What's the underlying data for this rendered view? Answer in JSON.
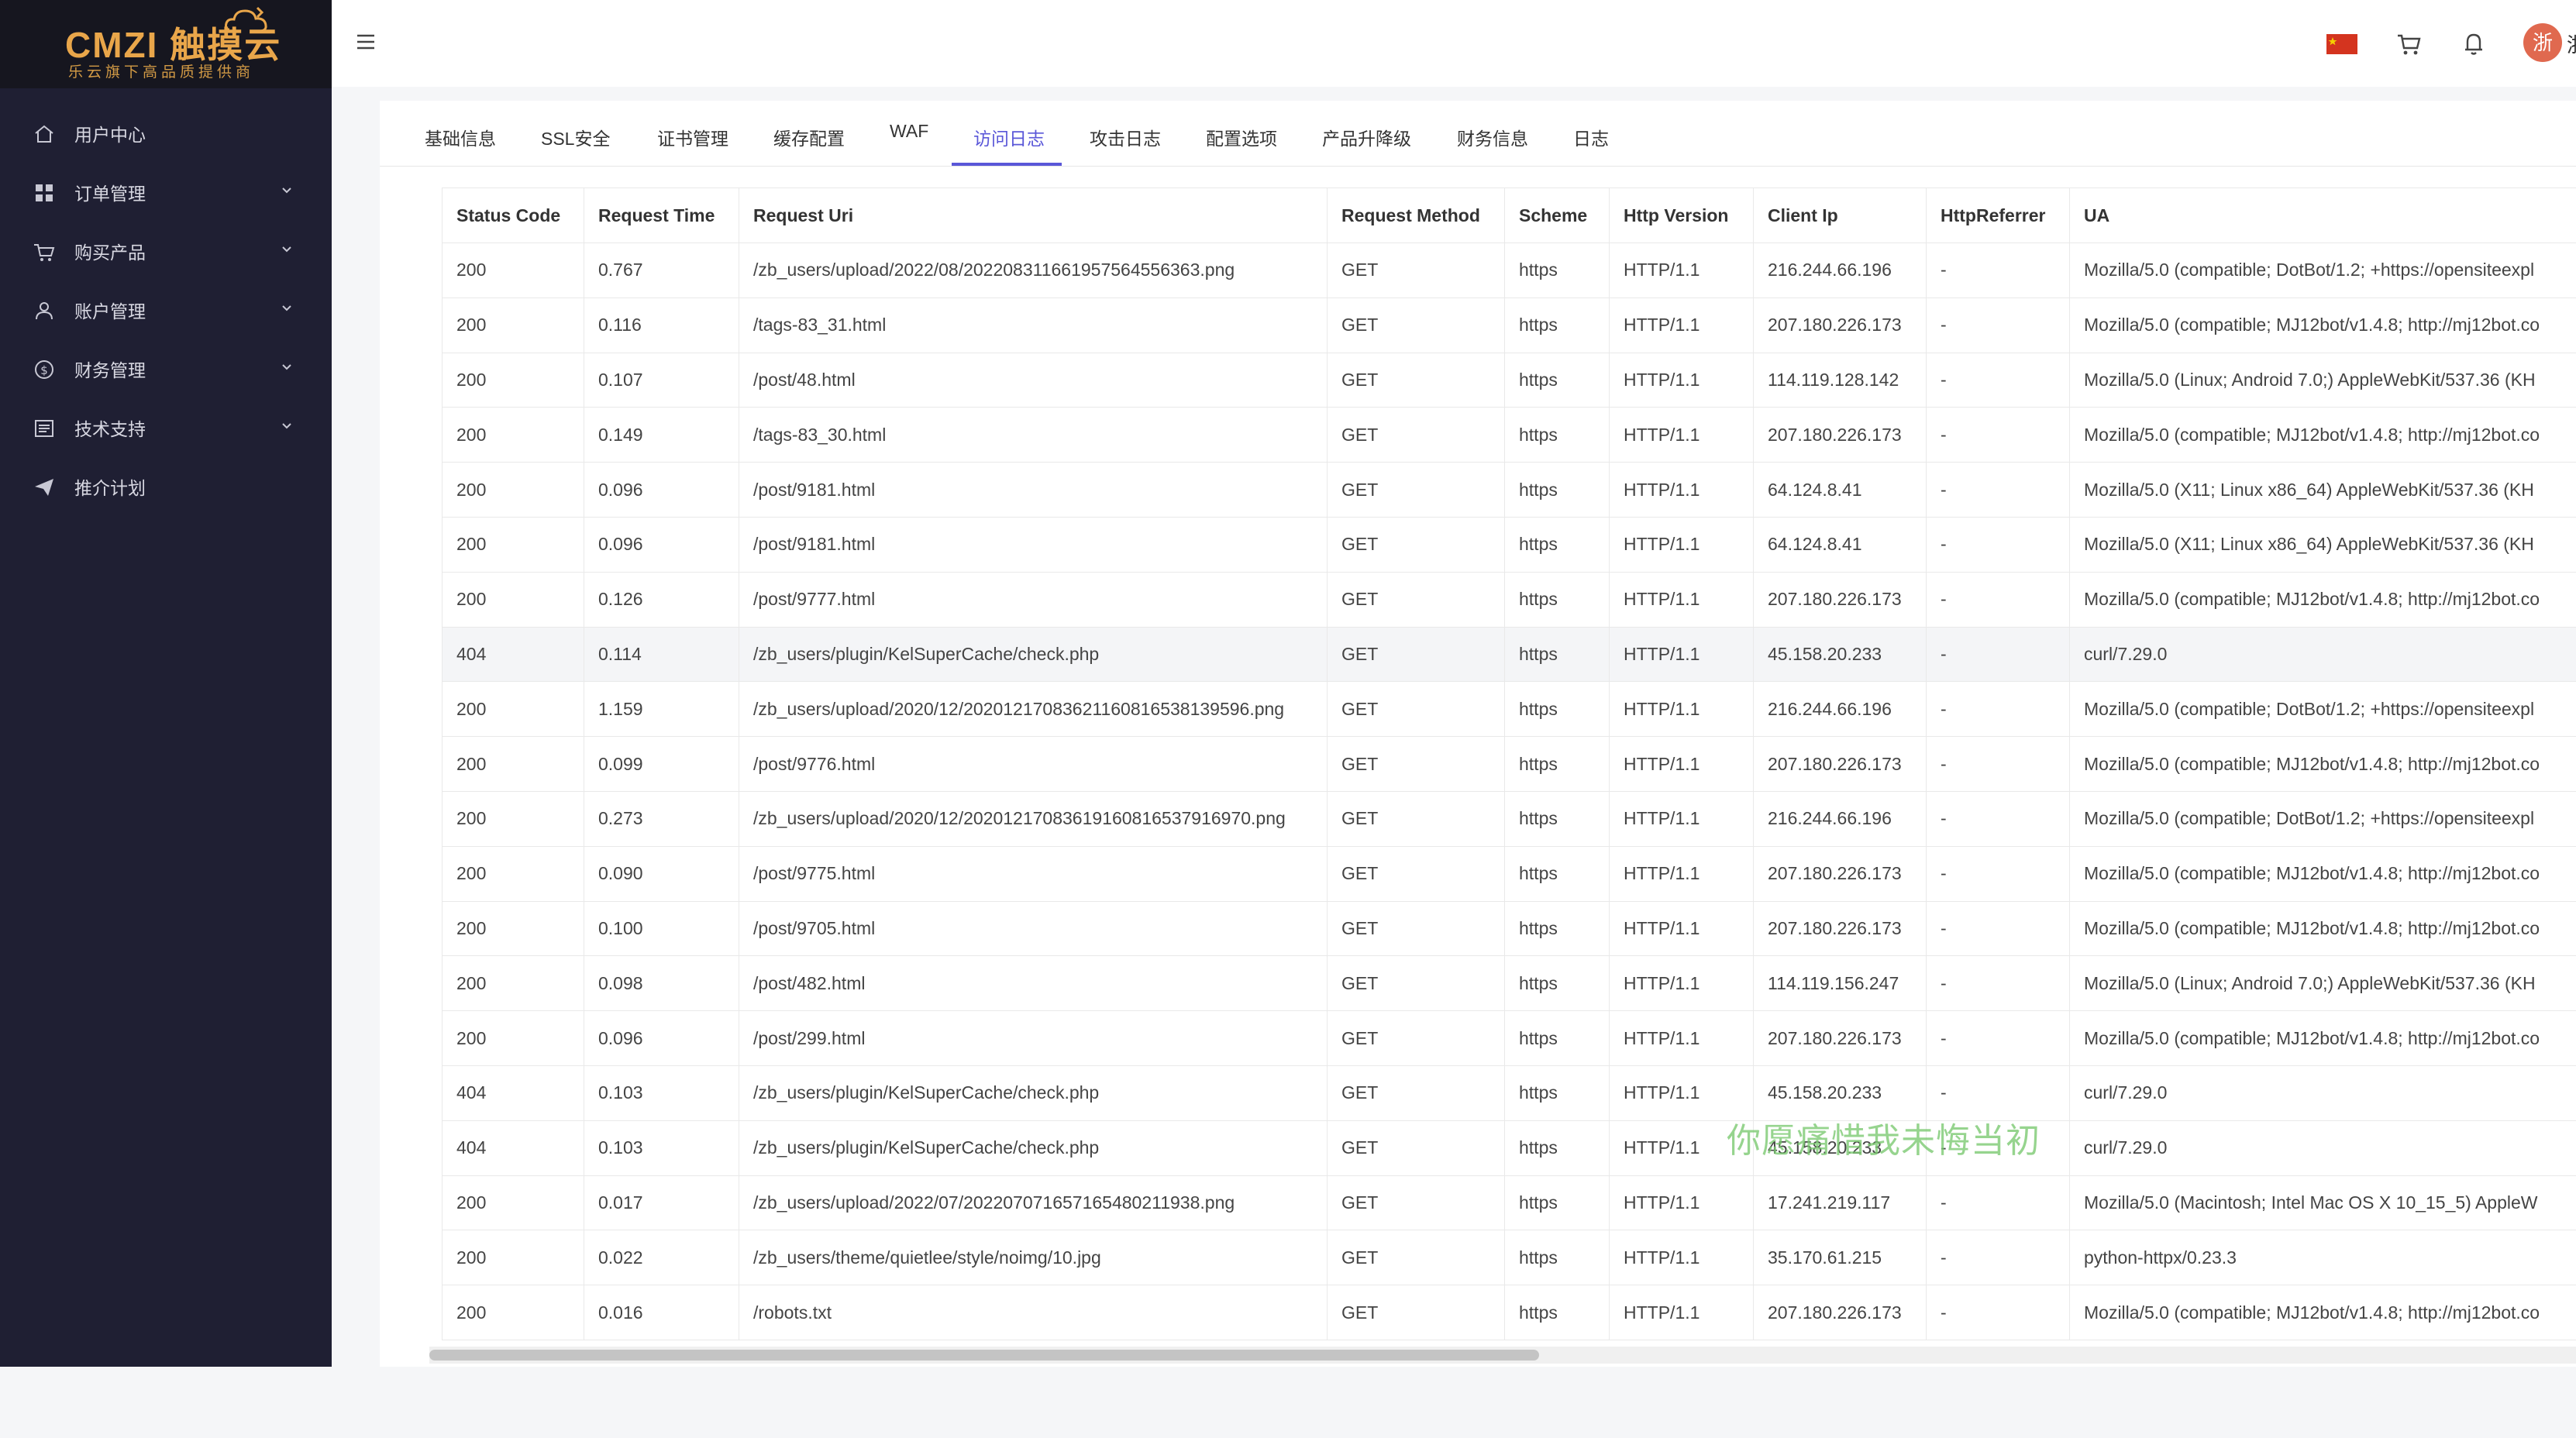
{
  "brand": {
    "name": "CMZI 触摸云",
    "tagline": "乐云旗下高品质提供商"
  },
  "sidebar": {
    "items": [
      {
        "label": "用户中心",
        "icon": "home-icon",
        "expandable": false
      },
      {
        "label": "订单管理",
        "icon": "grid-icon",
        "expandable": true
      },
      {
        "label": "购买产品",
        "icon": "cart-icon",
        "expandable": true
      },
      {
        "label": "账户管理",
        "icon": "user-icon",
        "expandable": true
      },
      {
        "label": "财务管理",
        "icon": "dollar-circle-icon",
        "expandable": true
      },
      {
        "label": "技术支持",
        "icon": "document-icon",
        "expandable": true
      },
      {
        "label": "推介计划",
        "icon": "send-icon",
        "expandable": false
      }
    ]
  },
  "header": {
    "icons": [
      "china-flag-icon",
      "cart-icon",
      "bell-icon"
    ],
    "avatar_text": "浙",
    "avatar_tail": "浙"
  },
  "tabs": {
    "items": [
      "基础信息",
      "SSL安全",
      "证书管理",
      "缓存配置",
      "WAF",
      "访问日志",
      "攻击日志",
      "配置选项",
      "产品升降级",
      "财务信息",
      "日志"
    ],
    "active": "访问日志"
  },
  "table": {
    "columns": [
      "Status Code",
      "Request Time",
      "Request Uri",
      "Request Method",
      "Scheme",
      "Http Version",
      "Client Ip",
      "HttpReferrer",
      "UA"
    ],
    "rows": [
      [
        "200",
        "0.767",
        "/zb_users/upload/2022/08/202208311661957564556363.png",
        "GET",
        "https",
        "HTTP/1.1",
        "216.244.66.196",
        "-",
        "Mozilla/5.0 (compatible; DotBot/1.2; +https://opensiteexpl"
      ],
      [
        "200",
        "0.116",
        "/tags-83_31.html",
        "GET",
        "https",
        "HTTP/1.1",
        "207.180.226.173",
        "-",
        "Mozilla/5.0 (compatible; MJ12bot/v1.4.8; http://mj12bot.co"
      ],
      [
        "200",
        "0.107",
        "/post/48.html",
        "GET",
        "https",
        "HTTP/1.1",
        "114.119.128.142",
        "-",
        "Mozilla/5.0 (Linux; Android 7.0;) AppleWebKit/537.36 (KH"
      ],
      [
        "200",
        "0.149",
        "/tags-83_30.html",
        "GET",
        "https",
        "HTTP/1.1",
        "207.180.226.173",
        "-",
        "Mozilla/5.0 (compatible; MJ12bot/v1.4.8; http://mj12bot.co"
      ],
      [
        "200",
        "0.096",
        "/post/9181.html",
        "GET",
        "https",
        "HTTP/1.1",
        "64.124.8.41",
        "-",
        "Mozilla/5.0 (X11; Linux x86_64) AppleWebKit/537.36 (KH"
      ],
      [
        "200",
        "0.096",
        "/post/9181.html",
        "GET",
        "https",
        "HTTP/1.1",
        "64.124.8.41",
        "-",
        "Mozilla/5.0 (X11; Linux x86_64) AppleWebKit/537.36 (KH"
      ],
      [
        "200",
        "0.126",
        "/post/9777.html",
        "GET",
        "https",
        "HTTP/1.1",
        "207.180.226.173",
        "-",
        "Mozilla/5.0 (compatible; MJ12bot/v1.4.8; http://mj12bot.co"
      ],
      [
        "404",
        "0.114",
        "/zb_users/plugin/KelSuperCache/check.php",
        "GET",
        "https",
        "HTTP/1.1",
        "45.158.20.233",
        "-",
        "curl/7.29.0"
      ],
      [
        "200",
        "1.159",
        "/zb_users/upload/2020/12/202012170836211608165381395​96.png",
        "GET",
        "https",
        "HTTP/1.1",
        "216.244.66.196",
        "-",
        "Mozilla/5.0 (compatible; DotBot/1.2; +https://opensiteexpl"
      ],
      [
        "200",
        "0.099",
        "/post/9776.html",
        "GET",
        "https",
        "HTTP/1.1",
        "207.180.226.173",
        "-",
        "Mozilla/5.0 (compatible; MJ12bot/v1.4.8; http://mj12bot.co"
      ],
      [
        "200",
        "0.273",
        "/zb_users/upload/2020/12/202012170836191608165379169​70.png",
        "GET",
        "https",
        "HTTP/1.1",
        "216.244.66.196",
        "-",
        "Mozilla/5.0 (compatible; DotBot/1.2; +https://opensiteexpl"
      ],
      [
        "200",
        "0.090",
        "/post/9775.html",
        "GET",
        "https",
        "HTTP/1.1",
        "207.180.226.173",
        "-",
        "Mozilla/5.0 (compatible; MJ12bot/v1.4.8; http://mj12bot.co"
      ],
      [
        "200",
        "0.100",
        "/post/9705.html",
        "GET",
        "https",
        "HTTP/1.1",
        "207.180.226.173",
        "-",
        "Mozilla/5.0 (compatible; MJ12bot/v1.4.8; http://mj12bot.co"
      ],
      [
        "200",
        "0.098",
        "/post/482.html",
        "GET",
        "https",
        "HTTP/1.1",
        "114.119.156.247",
        "-",
        "Mozilla/5.0 (Linux; Android 7.0;) AppleWebKit/537.36 (KH"
      ],
      [
        "200",
        "0.096",
        "/post/299.html",
        "GET",
        "https",
        "HTTP/1.1",
        "207.180.226.173",
        "-",
        "Mozilla/5.0 (compatible; MJ12bot/v1.4.8; http://mj12bot.co"
      ],
      [
        "404",
        "0.103",
        "/zb_users/plugin/KelSuperCache/check.php",
        "GET",
        "https",
        "HTTP/1.1",
        "45.158.20.233",
        "-",
        "curl/7.29.0"
      ],
      [
        "404",
        "0.103",
        "/zb_users/plugin/KelSuperCache/check.php",
        "GET",
        "https",
        "HTTP/1.1",
        "45.158.20.233",
        "-",
        "curl/7.29.0"
      ],
      [
        "200",
        "0.017",
        "/zb_users/upload/2022/07/202207071657165480211938.png",
        "GET",
        "https",
        "HTTP/1.1",
        "17.241.219.117",
        "-",
        "Mozilla/5.0 (Macintosh; Intel Mac OS X 10_15_5) AppleW"
      ],
      [
        "200",
        "0.022",
        "/zb_users/theme/quietlee/style/noimg/10.jpg",
        "GET",
        "https",
        "HTTP/1.1",
        "35.170.61.215",
        "-",
        "python-httpx/0.23.3"
      ],
      [
        "200",
        "0.016",
        "/robots.txt",
        "GET",
        "https",
        "HTTP/1.1",
        "207.180.226.173",
        "-",
        "Mozilla/5.0 (compatible; MJ12bot/v1.4.8; http://mj12bot.co"
      ]
    ],
    "highlighted_row": 7
  },
  "watermark": "你愿痛惜我未悔当初"
}
